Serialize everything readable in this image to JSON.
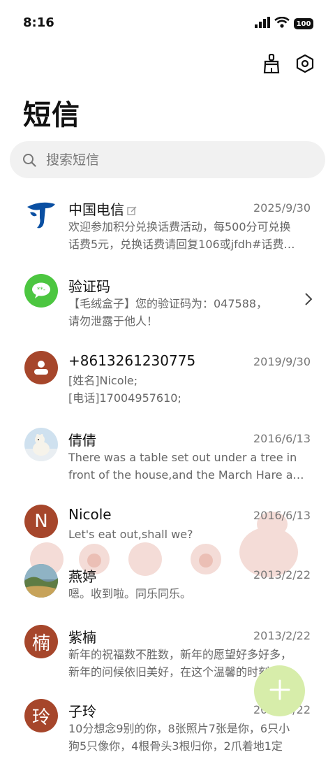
{
  "status": {
    "time": "8:16",
    "battery": "100"
  },
  "header": {
    "title": "短信"
  },
  "search": {
    "placeholder": "搜索短信"
  },
  "conversations": [
    {
      "name": "中国电信",
      "date": "2025/9/30",
      "line1": "欢迎参加积分兑换话费活动，每500分可兑换",
      "line2": "话费5元，兑换话费请回复106或jfdh#话费…",
      "avatar": "china-telecom-logo"
    },
    {
      "name": "验证码",
      "date": "",
      "line1": "【毛绒盒子】您的验证码为：047588，",
      "line2": "请勿泄露于他人！",
      "avatar": "message-bubble-icon"
    },
    {
      "name": "+8613261230775",
      "date": "2019/9/30",
      "line1": "[姓名]Nicole;",
      "line2": "[电话]17004957610;",
      "avatar": "person-icon"
    },
    {
      "name": "倩倩",
      "date": "2016/6/13",
      "line1": "There was a table set out under a tree in",
      "line2": "front of the house,and the March Hare an…",
      "avatar": "polar-bear-photo"
    },
    {
      "name": "Nicole",
      "date": "2016/6/13",
      "line1": "Let's eat out,shall we?",
      "line2": "",
      "avatar_letter": "N"
    },
    {
      "name": "燕婷",
      "date": "2013/2/22",
      "line1": "嗯。收到啦。同乐同乐。",
      "line2": "",
      "avatar": "landscape-photo"
    },
    {
      "name": "紫楠",
      "date": "2013/2/22",
      "line1": "新年的祝福数不胜数，新年的愿望好多好多，",
      "line2": "新年的问候依旧美好，在这个温馨的时刻…",
      "avatar_letter": "楠"
    },
    {
      "name": "子玲",
      "date": "2013/2/22",
      "line1": "10分想念9别的你，8张照片7张是你，6只小",
      "line2": "狗5只像你，4根骨头3根归你，2爪着地1定",
      "avatar_letter": "玲"
    }
  ],
  "colors": {
    "accent_brown": "#a6462b",
    "green_bubble": "#4cc640",
    "telecom_blue": "#0a4fa2",
    "fab": "#d7edaa"
  }
}
